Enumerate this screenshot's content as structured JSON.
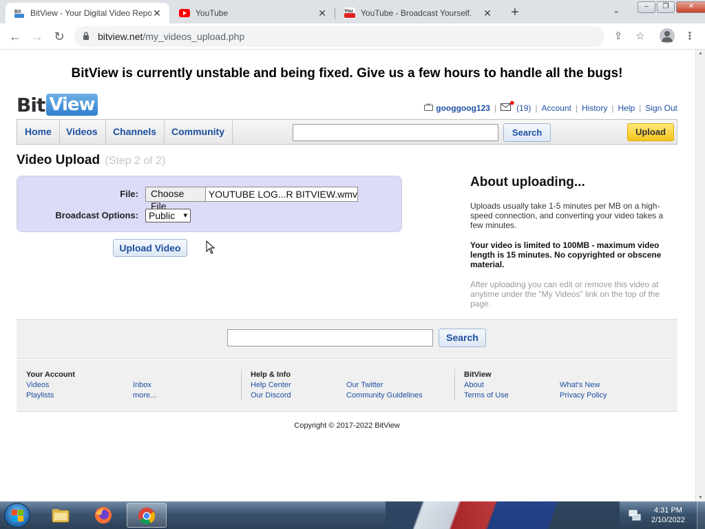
{
  "browser": {
    "tabs": [
      {
        "title": "BitView - Your Digital Video Repo",
        "favicon": "bitview-favicon-icon",
        "active": true
      },
      {
        "title": "YouTube",
        "favicon": "youtube-favicon-icon",
        "active": false
      },
      {
        "title": "YouTube - Broadcast Yourself.",
        "favicon": "youtube-old-favicon-icon",
        "active": false
      }
    ],
    "url_host": "bitview.net",
    "url_path": "/my_videos_upload.php"
  },
  "page": {
    "banner": "BitView is currently unstable and being fixed. Give us a few hours to handle all the bugs!",
    "logo": {
      "part1": "Bit",
      "part2": "View"
    },
    "userbar": {
      "username": "googgoog123",
      "inbox_count": "(19)",
      "links": [
        "Account",
        "History",
        "Help",
        "Sign Out"
      ]
    },
    "nav": {
      "items": [
        "Home",
        "Videos",
        "Channels",
        "Community"
      ],
      "search_label": "Search",
      "upload_label": "Upload"
    },
    "upload": {
      "title": "Video Upload",
      "step": "(Step 2 of 2)",
      "file_label": "File:",
      "choose_file": "Choose File",
      "file_name": "YOUTUBE LOG...R BITVIEW.wmv",
      "broadcast_label": "Broadcast Options:",
      "broadcast_value": "Public",
      "submit_label": "Upload Video"
    },
    "about": {
      "heading": "About uploading...",
      "p1": "Uploads usually take 1-5 minutes per MB on a high-speed connection, and converting your video takes a few minutes.",
      "p2": "Your video is limited to 100MB - maximum video length is 15 minutes. No copyrighted or obscene material.",
      "p3": "After uploading you can edit or remove this video at anytime under the \"My Videos\" link on the top of the page."
    },
    "footer": {
      "search_label": "Search",
      "your_account": {
        "heading": "Your Account",
        "links": [
          "Videos",
          "Inbox",
          "Playlists",
          "more..."
        ]
      },
      "help_info": {
        "heading": "Help & Info",
        "links": [
          "Help Center",
          "Our Twitter",
          "Our Discord",
          "Community Guidelines"
        ]
      },
      "bitview": {
        "heading": "BitView",
        "links": [
          "About",
          "What's New",
          "Terms of Use",
          "Privacy Policy"
        ]
      },
      "copyright": "Copyright © 2017-2022 BitView"
    }
  },
  "taskbar": {
    "apps": [
      "file-explorer-icon",
      "firefox-icon",
      "chrome-icon"
    ],
    "time": "4:31 PM",
    "date": "2/10/2022"
  },
  "colors": {
    "link": "#1d4fa0",
    "form_bg": "#dcdcf8",
    "upload_btn": "#f4c61c"
  }
}
